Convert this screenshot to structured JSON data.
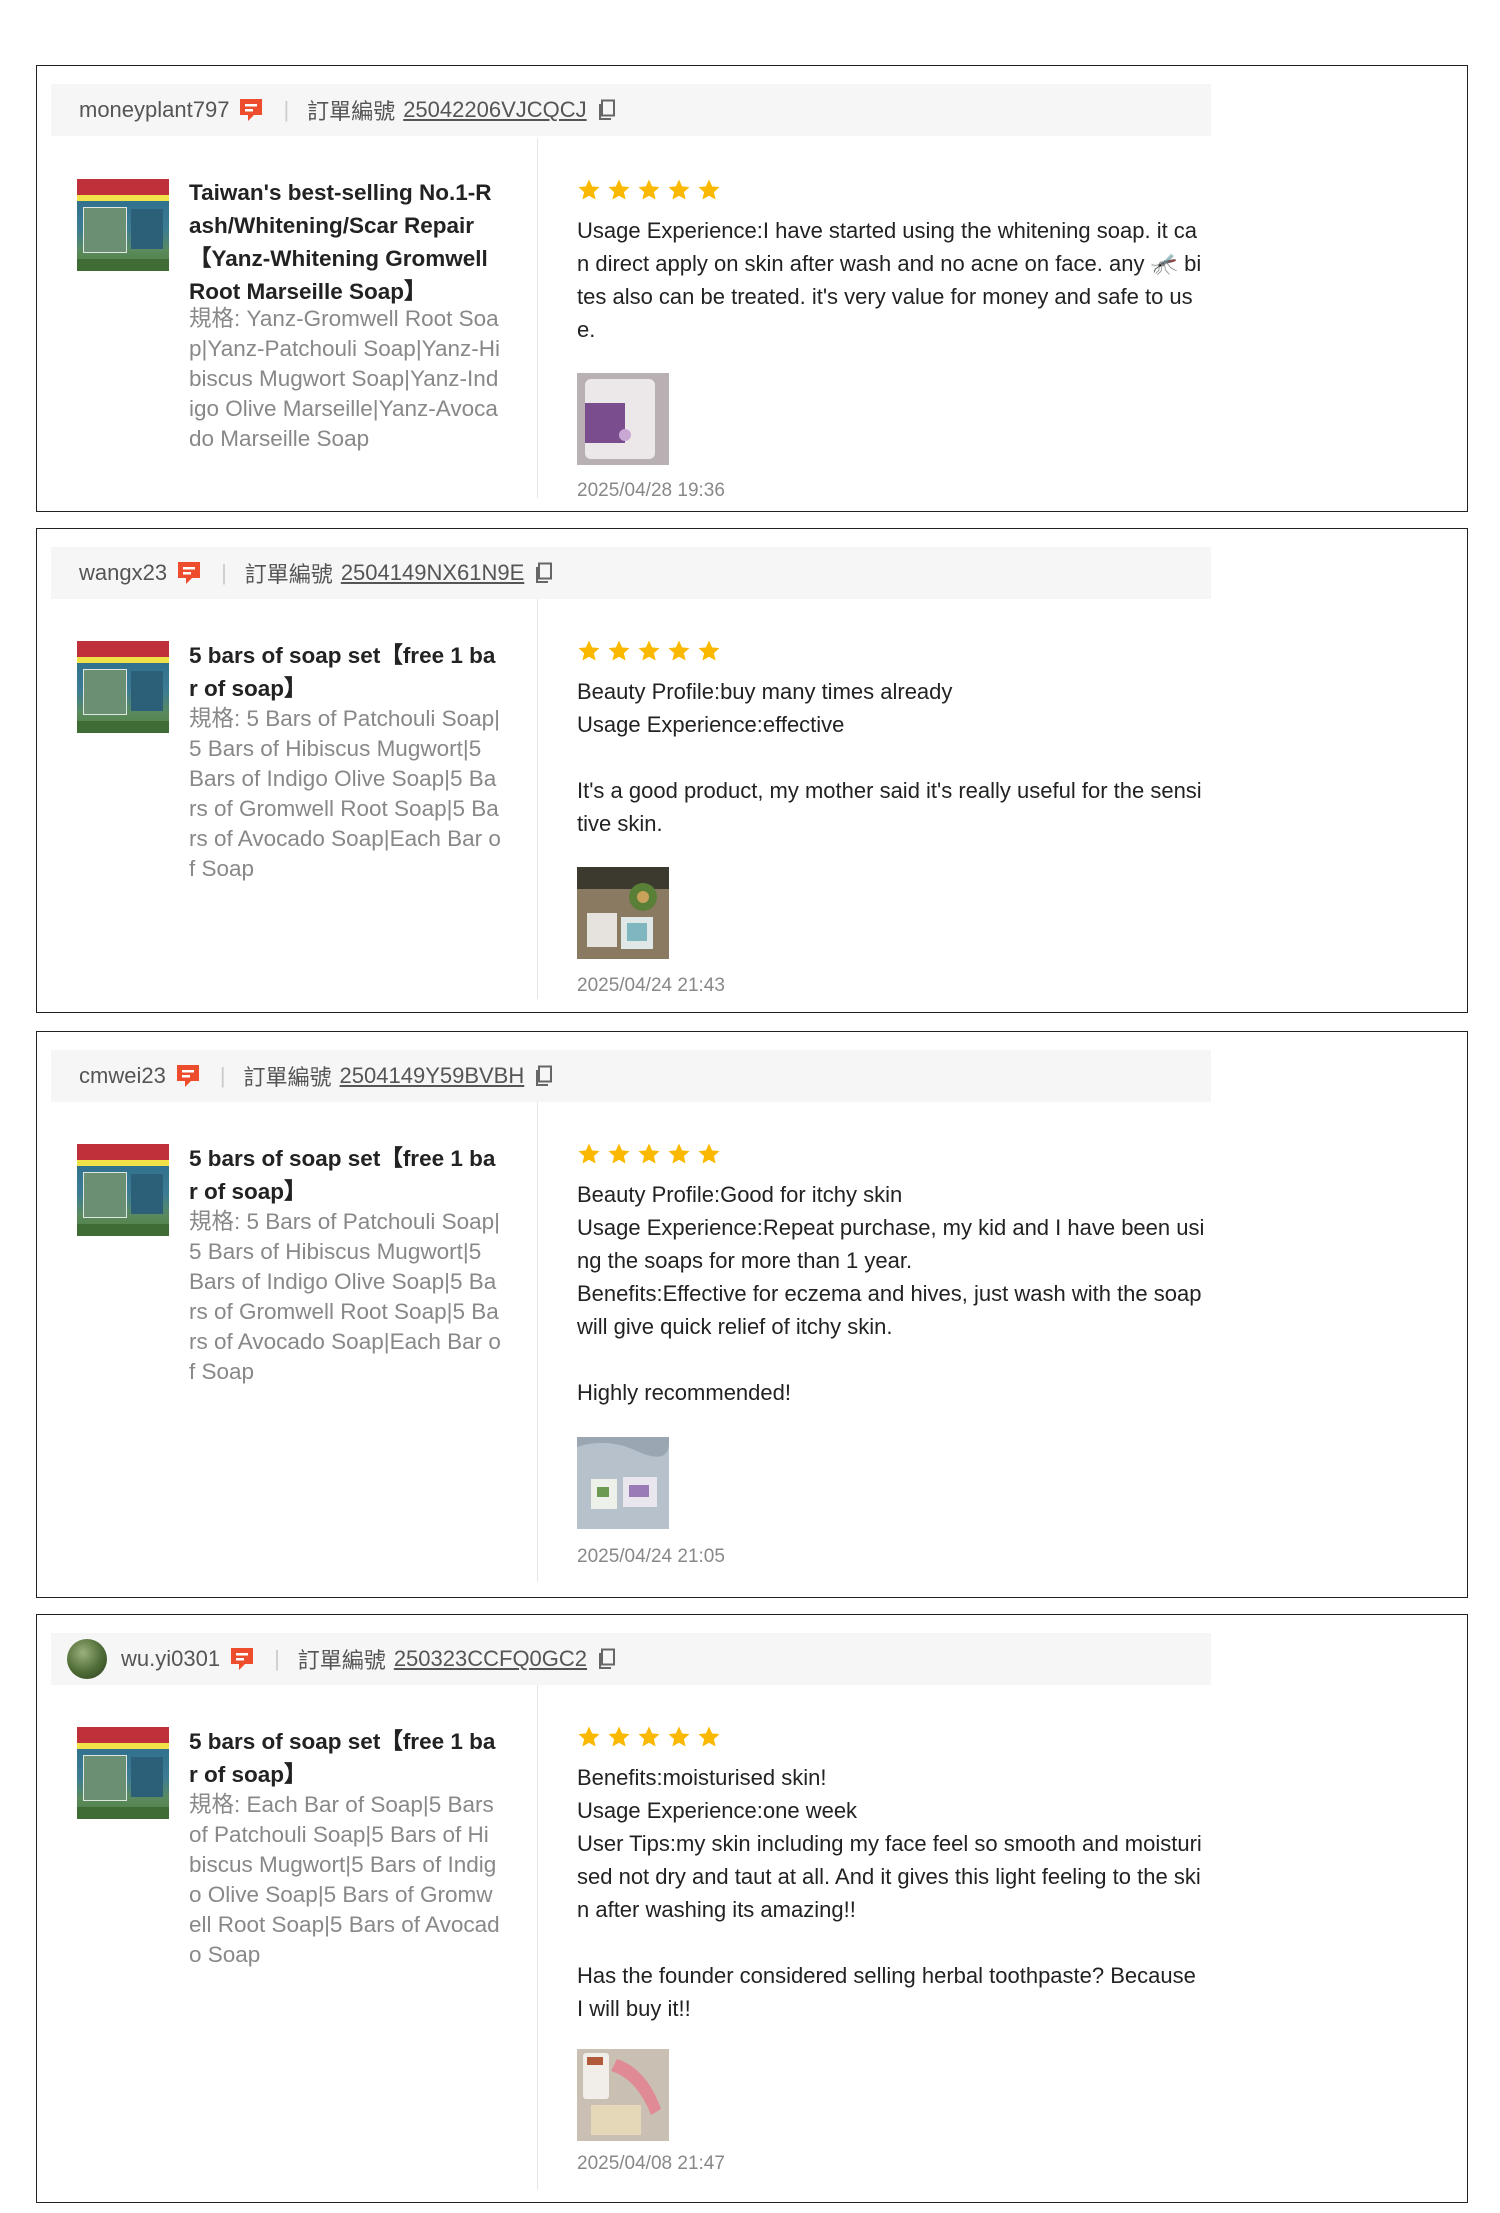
{
  "order_label": "訂單編號",
  "reviews": [
    {
      "username": "moneyplant797",
      "order_no": "25042206VJCQCJ",
      "product_title": "Taiwan's best-selling No.1-Rash/Whitening/Scar Repair【Yanz-Whitening Gromwell Root Marseille Soap】",
      "spec": "規格: Yanz-Gromwell Root Soap|Yanz-Patchouli Soap|Yanz-Hibiscus Mugwort Soap|Yanz-Indigo Olive Marseille|Yanz-Avocado Marseille Soap",
      "rating": 5,
      "review_text": "Usage Experience:I have started using the whitening soap. it can direct apply on skin after wash and no acne on face. any 🦟 bites also can be treated. it's very value for money and safe to use.",
      "date": "2025/04/28 19:36"
    },
    {
      "username": "wangx23",
      "order_no": "2504149NX61N9E",
      "product_title": "5 bars of soap set【free 1 bar of soap】",
      "spec": "規格: 5 Bars of Patchouli Soap|5 Bars of Hibiscus Mugwort|5 Bars of Indigo Olive Soap|5 Bars of Gromwell Root Soap|5 Bars of Avocado Soap|Each Bar of Soap",
      "rating": 5,
      "review_text": "Beauty Profile:buy many times already\nUsage Experience:effective\n\nIt's a good product, my mother said it's really useful for the sensitive skin.",
      "date": "2025/04/24 21:43"
    },
    {
      "username": "cmwei23",
      "order_no": "2504149Y59BVBH",
      "product_title": "5 bars of soap set【free 1 bar of soap】",
      "spec": "規格: 5 Bars of Patchouli Soap|5 Bars of Hibiscus Mugwort|5 Bars of Indigo Olive Soap|5 Bars of Gromwell Root Soap|5 Bars of Avocado Soap|Each Bar of Soap",
      "rating": 5,
      "review_text": "Beauty Profile:Good for itchy skin\nUsage Experience:Repeat purchase, my kid and I have been using the soaps for more than 1 year.\nBenefits:Effective for eczema and hives, just wash with the soap will give quick relief of itchy skin.\n\nHighly recommended!",
      "date": "2025/04/24 21:05"
    },
    {
      "username": "wu.yi0301",
      "order_no": "250323CCFQ0GC2",
      "product_title": "5 bars of soap set【free 1 bar of soap】",
      "spec": "規格: Each Bar of Soap|5 Bars of Patchouli Soap|5 Bars of Hibiscus Mugwort|5 Bars of Indigo Olive Soap|5 Bars of Gromwell Root Soap|5 Bars of Avocado Soap",
      "rating": 5,
      "review_text": "Benefits:moisturised skin!\nUsage Experience:one week\nUser Tips:my skin including my face feel so smooth and moisturised not dry and taut at all. And it gives this light feeling to the skin after washing its amazing!!\n\nHas the founder considered selling herbal toothpaste? Because I will buy it!!",
      "date": "2025/04/08 21:47"
    }
  ],
  "colors": {
    "star": "#fbb800",
    "chat_icon": "#ee4d2d",
    "border": "#222222",
    "header_bg": "#f6f6f6"
  },
  "icons": {
    "chat": "chat-bubble-icon",
    "copy": "copy-icon",
    "star": "star-icon"
  }
}
